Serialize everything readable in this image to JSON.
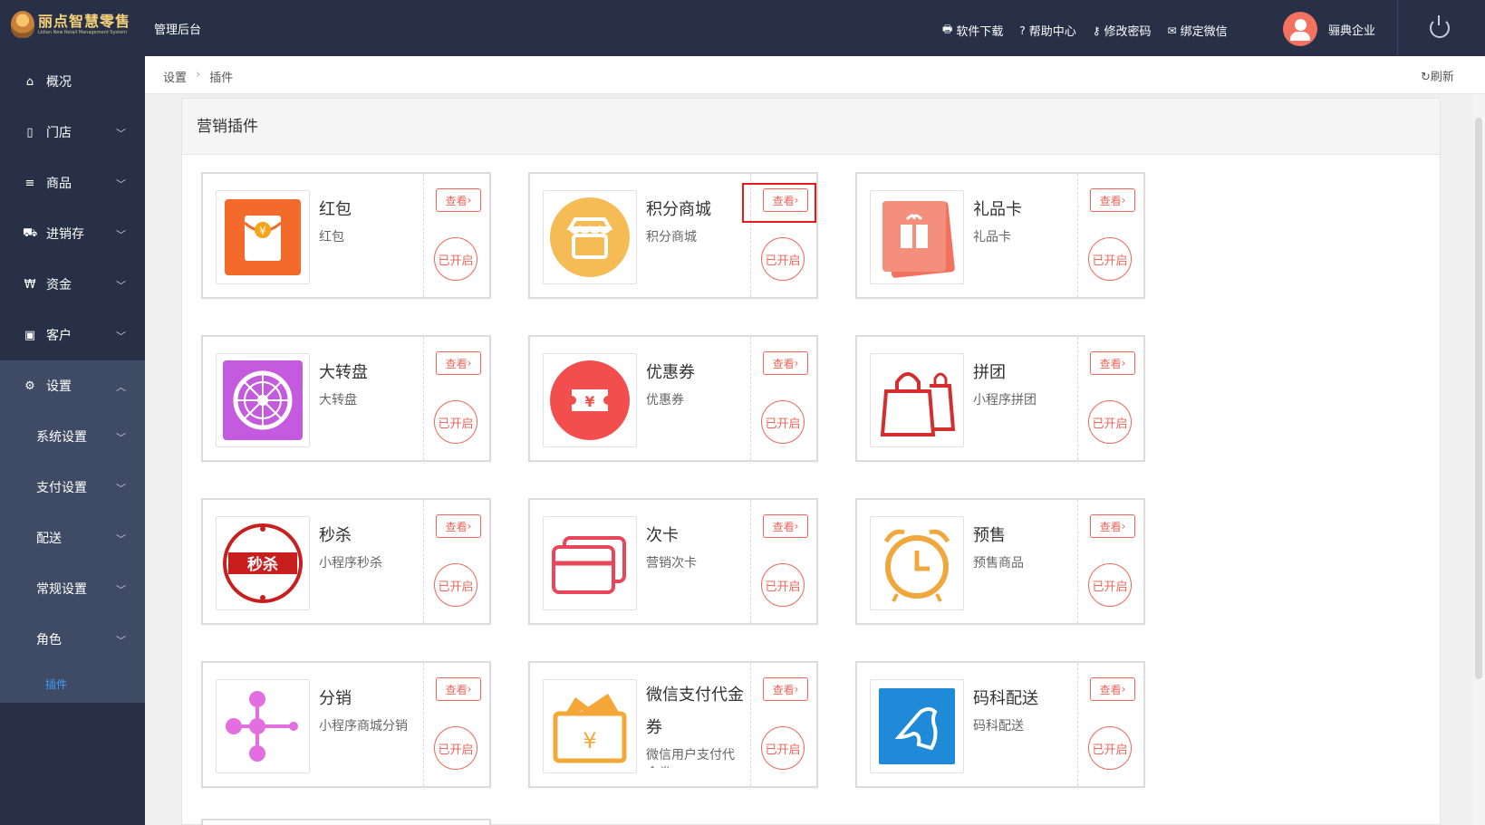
{
  "brand": {
    "name": "丽点智慧零售",
    "tagline": "Lidian New Retail Management System"
  },
  "header": {
    "admin_title": "管理后台",
    "links": [
      {
        "icon": "printer-icon",
        "glyph": "🖶",
        "label": "软件下载"
      },
      {
        "icon": "help-icon",
        "glyph": "?",
        "label": "帮助中心"
      },
      {
        "icon": "key-icon",
        "glyph": "⚷",
        "label": "修改密码"
      },
      {
        "icon": "wechat-icon",
        "glyph": "✉",
        "label": "绑定微信"
      }
    ],
    "company": "骊典企业"
  },
  "sidebar": {
    "items": [
      {
        "key": "overview",
        "glyph": "⌂",
        "label": "概况"
      },
      {
        "key": "store",
        "glyph": "▯",
        "label": "门店"
      },
      {
        "key": "goods",
        "glyph": "≡",
        "label": "商品"
      },
      {
        "key": "inventory",
        "glyph": "⛟",
        "label": "进销存"
      },
      {
        "key": "funds",
        "glyph": "₩",
        "label": "资金"
      },
      {
        "key": "customer",
        "glyph": "▣",
        "label": "客户"
      },
      {
        "key": "settings",
        "glyph": "⚙",
        "label": "设置"
      }
    ],
    "sub_items": [
      {
        "label": "系统设置"
      },
      {
        "label": "支付设置"
      },
      {
        "label": "配送"
      },
      {
        "label": "常规设置"
      },
      {
        "label": "角色"
      }
    ],
    "active_leaf": "插件"
  },
  "breadcrumb": {
    "root": "设置",
    "current": "插件"
  },
  "refresh_label": "刷新",
  "panel": {
    "title": "营销插件"
  },
  "common": {
    "view_label": "查看",
    "status_label": "已开启"
  },
  "plugins": [
    {
      "name": "红包",
      "desc": "红包",
      "icon": "red-envelope-icon"
    },
    {
      "name": "积分商城",
      "desc": "积分商城",
      "icon": "points-mall-icon"
    },
    {
      "name": "礼品卡",
      "desc": "礼品卡",
      "icon": "gift-card-icon"
    },
    {
      "name": "大转盘",
      "desc": "大转盘",
      "icon": "lucky-wheel-icon"
    },
    {
      "name": "优惠券",
      "desc": "优惠券",
      "icon": "coupon-icon"
    },
    {
      "name": "拼团",
      "desc": "小程序拼团",
      "icon": "group-buy-icon"
    },
    {
      "name": "秒杀",
      "desc": "小程序秒杀",
      "icon": "flash-sale-icon"
    },
    {
      "name": "次卡",
      "desc": "营销次卡",
      "icon": "punch-card-icon"
    },
    {
      "name": "预售",
      "desc": "预售商品",
      "icon": "presale-icon"
    },
    {
      "name": "分销",
      "desc": "小程序商城分销",
      "icon": "distribution-icon"
    },
    {
      "name": "微信支付代金券",
      "desc": "微信用户支付代金券",
      "icon": "wechat-voucher-icon"
    },
    {
      "name": "码科配送",
      "desc": "码科配送",
      "icon": "maker-delivery-icon"
    }
  ],
  "colors": {
    "sidebar_bg": "#273046",
    "accent": "#f0655a",
    "active_link": "#3aa0ff"
  }
}
